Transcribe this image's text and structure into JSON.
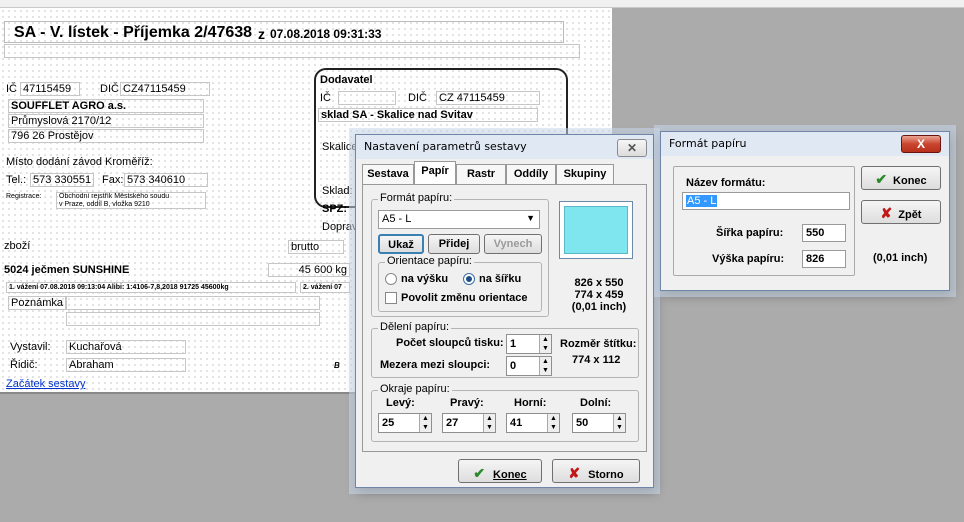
{
  "report": {
    "title": "SA - V. lístek - Příjemka 2/47638",
    "z": "z",
    "datetime": "07.08.2018 09:31:33",
    "left": {
      "ic_label": "IČ",
      "ic": "47115459",
      "dic_label": "DIČ",
      "dic": "CZ47115459",
      "company": "SOUFFLET AGRO a.s.",
      "street": "Průmyslová 2170/12",
      "city": "796 26 Prostějov",
      "place_label": "Místo dodání závod Kroměříž:",
      "tel_label": "Tel.:",
      "tel": "573 330551",
      "fax_label": "Fax:",
      "fax": "573 340610",
      "registr_label": "Registrace:",
      "registr_1": "Obchodní rejstřík Městského soudu",
      "registr_2": "v Praze, oddíl B, vložka 9210"
    },
    "supplier": {
      "heading": "Dodavatel",
      "ic_label": "IČ",
      "dic_label": "DIČ",
      "dic": "CZ 47115459",
      "name": "sklad SA - Skalice nad Svitav",
      "cut1": "Skalice",
      "cut2": "Sklad:",
      "cut3": "SPZ:",
      "cut4": "Doprav"
    },
    "goods_label": "zboží",
    "brutto_label": "brutto",
    "item": "5024 ječmen SUNSHINE",
    "weight": "45 600 kg",
    "weighing_1": "1. vážení  07.08.2018 09:13:04  Alibi: 1:4106-7,8,2018 91725 45600kg",
    "weighing_2": "2. vážení  07",
    "note_label": "Poznámka",
    "issued_label": "Vystavil:",
    "issued": "Kuchařová",
    "driver_label": "Řidič:",
    "driver": "Abraham",
    "cut_b": "B",
    "link": "Začátek sestavy"
  },
  "dialog1": {
    "title": "Nastavení parametrů sestavy",
    "close": "✕",
    "tabs": [
      "Sestava",
      "Papír",
      "Rastr",
      "Oddíly",
      "Skupiny"
    ],
    "format_group": "Formát papíru:",
    "format_value": "A5 - L",
    "btn_show": "Ukaž",
    "btn_add": "Přidej",
    "btn_remove": "Vynech",
    "orient_group": "Orientace papíru:",
    "portrait": "na výšku",
    "landscape": "na šířku",
    "allow_change": "Povolit změnu orientace",
    "dims_1": "826 x 550",
    "dims_2": "774 x 459",
    "dims_unit": "(0,01 inch)",
    "division_group": "Dělení papíru:",
    "cols_label": "Počet sloupců tisku:",
    "cols_value": "1",
    "gap_label": "Mezera mezi sloupci:",
    "gap_value": "0",
    "label_size_title": "Rozměr štítku:",
    "label_size": "774 x 112",
    "margins_group": "Okraje papíru:",
    "m_left_label": "Levý:",
    "m_right_label": "Pravý:",
    "m_top_label": "Horní:",
    "m_bottom_label": "Dolní:",
    "m_left": "25",
    "m_right": "27",
    "m_top": "41",
    "m_bottom": "50",
    "ok": "Konec",
    "cancel": "Storno"
  },
  "dialog2": {
    "title": "Formát papíru",
    "close": "X",
    "name_label": "Název formátu:",
    "name_value": "A5 - L",
    "width_label": "Šířka papíru:",
    "width_value": "550",
    "height_label": "Výška papíru:",
    "height_value": "826",
    "unit": "(0,01 inch)",
    "ok": "Konec",
    "back": "Zpět"
  },
  "colors": {
    "ok_green": "#2a8a2a",
    "cancel_red": "#c01818",
    "selection_blue": "#3399ff",
    "preview_cyan": "#7fe6f0"
  }
}
